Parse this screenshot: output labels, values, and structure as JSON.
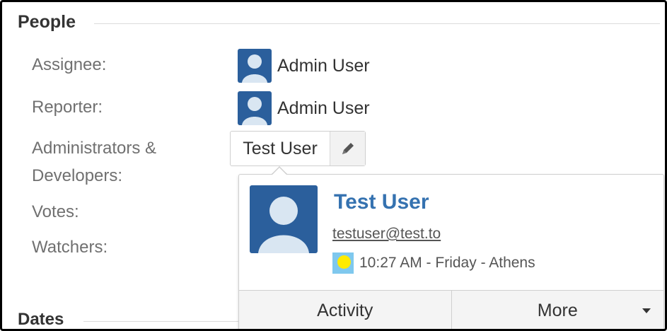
{
  "sections": {
    "people": "People",
    "dates": "Dates"
  },
  "fields": {
    "assignee_label": "Assignee:",
    "reporter_label": "Reporter:",
    "admins_label_line1": "Administrators &",
    "admins_label_line2": "Developers:",
    "votes_label": "Votes:",
    "watchers_label": "Watchers:"
  },
  "assignee": {
    "name": "Admin User"
  },
  "reporter": {
    "name": "Admin User"
  },
  "admins_chip": {
    "name": "Test User",
    "icon": "pencil-icon"
  },
  "user_card": {
    "name": "Test User",
    "email": "testuser@test.to",
    "time": "10:27 AM - Friday - Athens",
    "time_icon": "sun-icon",
    "buttons": {
      "activity": "Activity",
      "more": "More"
    }
  },
  "colors": {
    "avatar_bg": "#2b5f9c",
    "link": "#3572b0",
    "label": "#707070"
  }
}
